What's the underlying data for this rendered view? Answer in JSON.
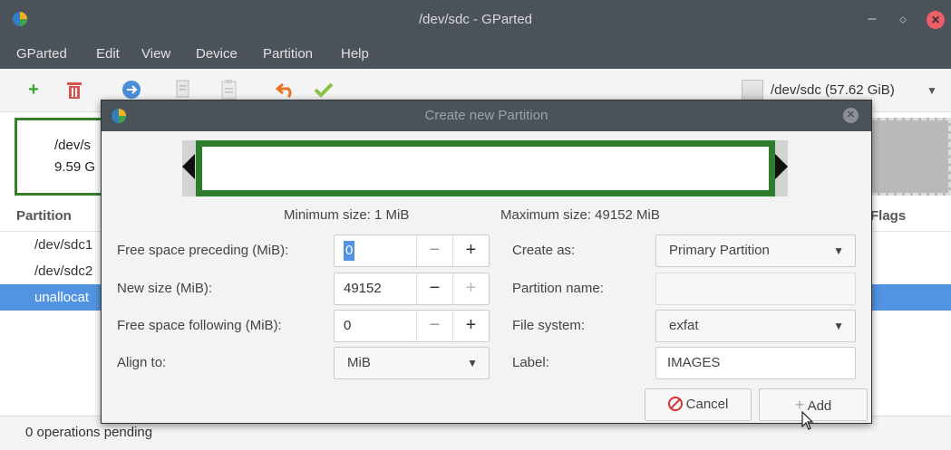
{
  "window": {
    "title": "/dev/sdc - GParted"
  },
  "menubar": {
    "items": [
      "GParted",
      "Edit",
      "View",
      "Device",
      "Partition",
      "Help"
    ]
  },
  "toolbar": {
    "icons": [
      "new-partition-icon",
      "delete-icon",
      "resize-move-icon",
      "copy-icon",
      "paste-icon",
      "undo-icon",
      "apply-icon"
    ],
    "device_label": "/dev/sdc (57.62 GiB)"
  },
  "partition_graphic": {
    "used_name": "/dev/s",
    "used_size": "9.59 G"
  },
  "partition_list": {
    "col_partition": "Partition",
    "col_flags": "Flags",
    "rows": [
      "/dev/sdc1",
      "/dev/sdc2",
      "unallocat"
    ]
  },
  "status": {
    "text": "0 operations pending"
  },
  "dialog": {
    "title": "Create new Partition",
    "min_size": "Minimum size: 1 MiB",
    "max_size": "Maximum size: 49152 MiB",
    "free_preceding_label": "Free space preceding (MiB):",
    "free_preceding_value": "0",
    "new_size_label": "New size (MiB):",
    "new_size_value": "49152",
    "free_following_label": "Free space following (MiB):",
    "free_following_value": "0",
    "align_label": "Align to:",
    "align_value": "MiB",
    "create_as_label": "Create as:",
    "create_as_value": "Primary Partition",
    "partition_name_label": "Partition name:",
    "partition_name_value": "",
    "file_system_label": "File system:",
    "file_system_value": "exfat",
    "label_label": "Label:",
    "label_value": "IMAGES",
    "cancel_label": "Cancel",
    "add_label": "Add",
    "spin_minus": "−",
    "spin_plus": "+"
  },
  "colors": {
    "titlebar": "#4b5259",
    "selection": "#5294e2",
    "partition_border": "#2e7d2e",
    "close_red": "#ec5f66"
  }
}
